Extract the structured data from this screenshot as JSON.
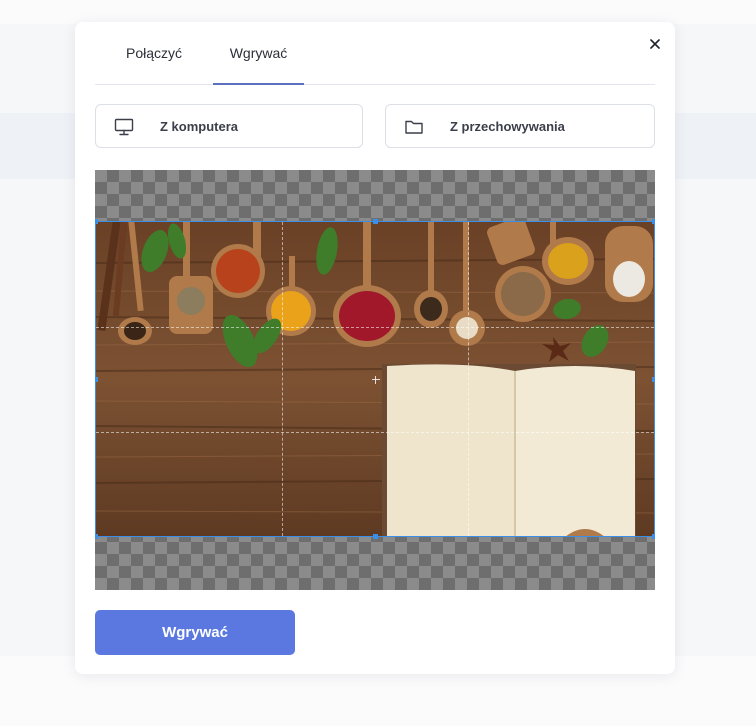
{
  "modal": {
    "tabs": [
      {
        "label": "Połączyć",
        "active": false
      },
      {
        "label": "Wgrywać",
        "active": true
      }
    ],
    "close_icon": "close-icon",
    "sources": {
      "computer": {
        "label": "Z komputera",
        "icon": "monitor-icon"
      },
      "storage": {
        "label": "Z przechowywania",
        "icon": "folder-icon"
      }
    },
    "upload_button_label": "Wgrywać"
  },
  "colors": {
    "accent": "#5b78e0",
    "tab_underline": "#5a6fbf",
    "crop_border": "#3b8fe6"
  }
}
